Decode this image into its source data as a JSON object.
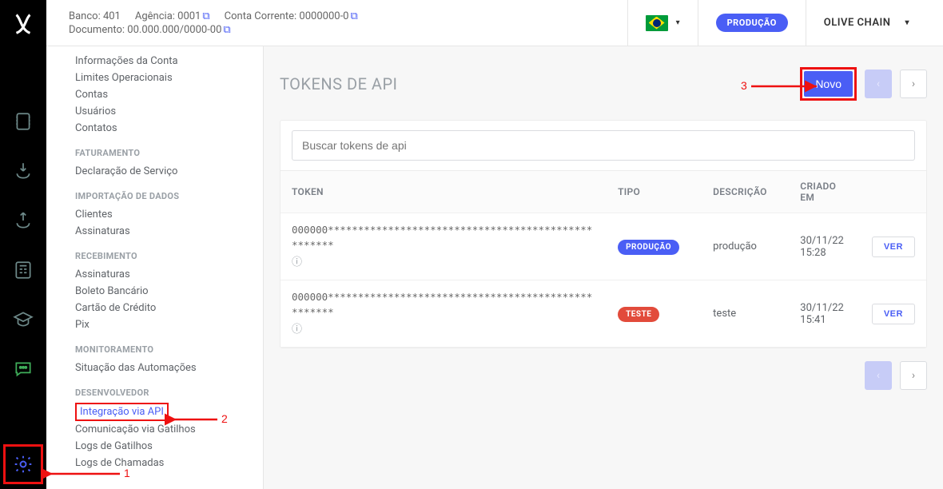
{
  "header": {
    "bank_label": "Banco: 401",
    "agency_label": "Agência: 0001",
    "account_label": "Conta Corrente: 0000000-0",
    "document_label": "Documento: 00.000.000/0000-00",
    "env_pill": "PRODUÇÃO",
    "account_name": "OLIVE CHAIN"
  },
  "sidebar": {
    "groups": [
      {
        "title": "",
        "items": [
          "Informações da Conta",
          "Limites Operacionais",
          "Contas",
          "Usuários",
          "Contatos"
        ]
      },
      {
        "title": "FATURAMENTO",
        "items": [
          "Declaração de Serviço"
        ]
      },
      {
        "title": "IMPORTAÇÃO DE DADOS",
        "items": [
          "Clientes",
          "Assinaturas"
        ]
      },
      {
        "title": "RECEBIMENTO",
        "items": [
          "Assinaturas",
          "Boleto Bancário",
          "Cartão de Crédito",
          "Pix"
        ]
      },
      {
        "title": "MONITORAMENTO",
        "items": [
          "Situação das Automações"
        ]
      },
      {
        "title": "DESENVOLVEDOR",
        "items": [
          "Integração via API",
          "Comunicação via Gatilhos",
          "Logs de Gatilhos",
          "Logs de Chamadas"
        ]
      }
    ]
  },
  "main": {
    "title": "TOKENS DE API",
    "new_button": "Novo",
    "search_placeholder": "Buscar tokens de api",
    "columns": {
      "token": "TOKEN",
      "type": "TIPO",
      "desc": "DESCRIÇÃO",
      "created": "CRIADO EM"
    },
    "view_button": "VER",
    "rows": [
      {
        "token": "000000***************************************************",
        "type_label": "PRODUÇÃO",
        "type_kind": "prod",
        "desc": "produção",
        "created": "30/11/22 15:28"
      },
      {
        "token": "000000***************************************************",
        "type_label": "TESTE",
        "type_kind": "test",
        "desc": "teste",
        "created": "30/11/22 15:41"
      }
    ]
  },
  "annotations": {
    "n1": "1",
    "n2": "2",
    "n3": "3"
  }
}
